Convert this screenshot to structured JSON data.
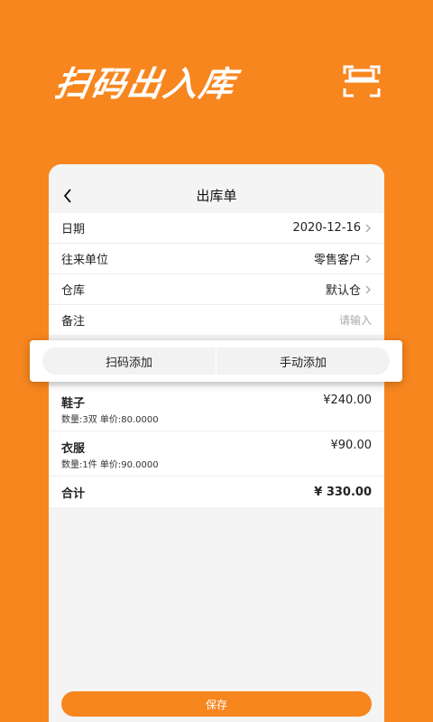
{
  "hero": {
    "title": "扫码出入库",
    "icon": "scan-icon"
  },
  "card": {
    "title": "出库单",
    "back_icon": "chevron-left-icon"
  },
  "form": {
    "rows": [
      {
        "label": "日期",
        "value": "2020-12-16",
        "chevron": true
      },
      {
        "label": "往来单位",
        "value": "零售客户",
        "chevron": true
      },
      {
        "label": "仓库",
        "value": "默认仓",
        "chevron": true
      },
      {
        "label": "备注",
        "placeholder": "请输入"
      }
    ]
  },
  "add_bar": {
    "scan_label": "扫码添加",
    "manual_label": "手动添加"
  },
  "items": [
    {
      "name": "鞋子",
      "price": "¥240.00",
      "detail": "数量:3双 单价:80.0000"
    },
    {
      "name": "衣服",
      "price": "¥90.00",
      "detail": "数量:1件 单价:90.0000"
    }
  ],
  "total": {
    "label": "合计",
    "value": "¥ 330.00"
  },
  "save": {
    "label": "保存"
  },
  "colors": {
    "accent": "#f7861f",
    "background": "#f4f4f4"
  }
}
